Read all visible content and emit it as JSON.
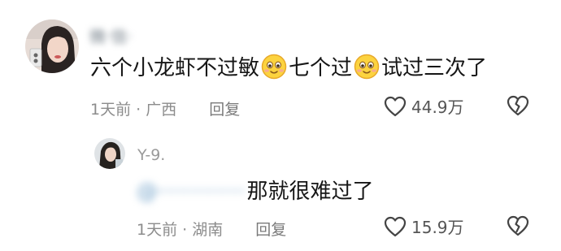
{
  "comment1": {
    "username": "微·信·",
    "text_part1": "六个小龙虾不过敏",
    "text_part2": "七个过",
    "text_part3": "试过三次了",
    "emoji_name": "blush-emoji",
    "meta": "1天前 · 广西",
    "reply_label": "回复",
    "like_count": "44.9万"
  },
  "comment2": {
    "username": "Y-9.",
    "mention": "@·············",
    "text": "那就很难过了",
    "meta": "1天前 · 湖南",
    "reply_label": "回复",
    "like_count": "15.9万"
  },
  "colors": {
    "text": "#161616",
    "meta": "#8c8c8c",
    "icon": "#444444"
  }
}
